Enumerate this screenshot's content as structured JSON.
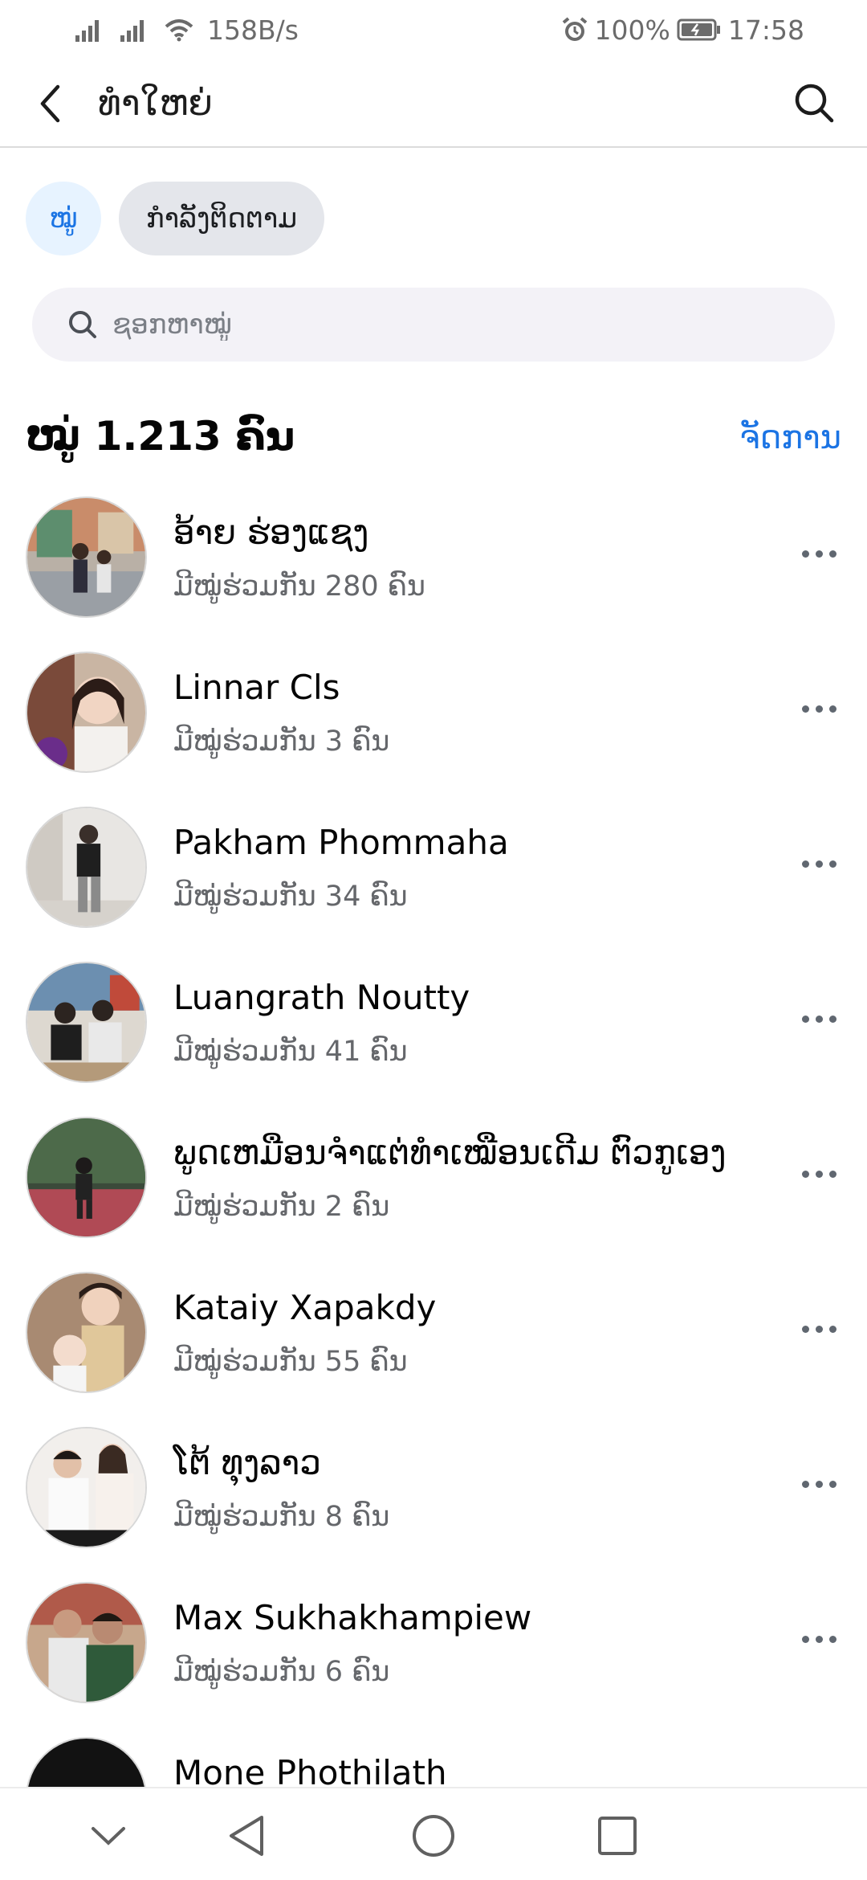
{
  "status_bar": {
    "net_speed": "158B/s",
    "battery": "100%",
    "time": "17:58",
    "icons": [
      "signal-icon",
      "signal-icon",
      "wifi-icon",
      "alarm-icon",
      "battery-icon"
    ]
  },
  "header": {
    "title": "ທຳໃຫຍ່",
    "back_icon": "back-arrow-icon",
    "search_icon": "search-icon"
  },
  "tabs": [
    {
      "label": "ໝູ່",
      "active": true
    },
    {
      "label": "ກຳລັງຕິດຕາມ",
      "active": false
    }
  ],
  "search": {
    "placeholder": "ຊອກຫາໝູ່",
    "value": ""
  },
  "section": {
    "title": "ໝູ່ 1.213 ຄົນ",
    "manage_label": "ຈັດການ"
  },
  "friends": [
    {
      "name": "ອ້າຍ ຮ່ອງແຊງ",
      "mutual": "ມີໝູ່ຮ່ວມກັນ 280 ຄົນ"
    },
    {
      "name": "Linnar Cls",
      "mutual": "ມີໝູ່ຮ່ວມກັນ 3 ຄົນ"
    },
    {
      "name": "Pakham Phommaha",
      "mutual": "ມີໝູ່ຮ່ວມກັນ 34 ຄົນ"
    },
    {
      "name": "Luangrath Noutty",
      "mutual": "ມີໝູ່ຮ່ວມກັນ 41 ຄົນ"
    },
    {
      "name": "ພູດເຫມືອນຈໍາແຕ່ທໍາເໝືອນເດີມ ຕົວກູເອງ",
      "mutual": "ມີໝູ່ຮ່ວມກັນ 2 ຄົນ"
    },
    {
      "name": "Kataiy Xapakdy",
      "mutual": "ມີໝູ່ຮ່ວມກັນ 55 ຄົນ"
    },
    {
      "name": "ໂຕ້ ທຸງລາວ",
      "mutual": "ມີໝູ່ຮ່ວມກັນ 8 ຄົນ"
    },
    {
      "name": "Max Sukhakhampiew",
      "mutual": "ມີໝູ່ຮ່ວມກັນ 6 ຄົນ"
    },
    {
      "name": "Mone Phothilath",
      "mutual": ""
    }
  ],
  "colors": {
    "accent": "#1b74e4",
    "tab_active_bg": "#e7f3ff",
    "tab_bg": "#e4e6eb",
    "search_bg": "#f3f2f7",
    "secondary_text": "#65676b"
  },
  "nav": [
    "collapse-icon",
    "back-triangle-icon",
    "home-circle-icon",
    "recents-square-icon"
  ]
}
